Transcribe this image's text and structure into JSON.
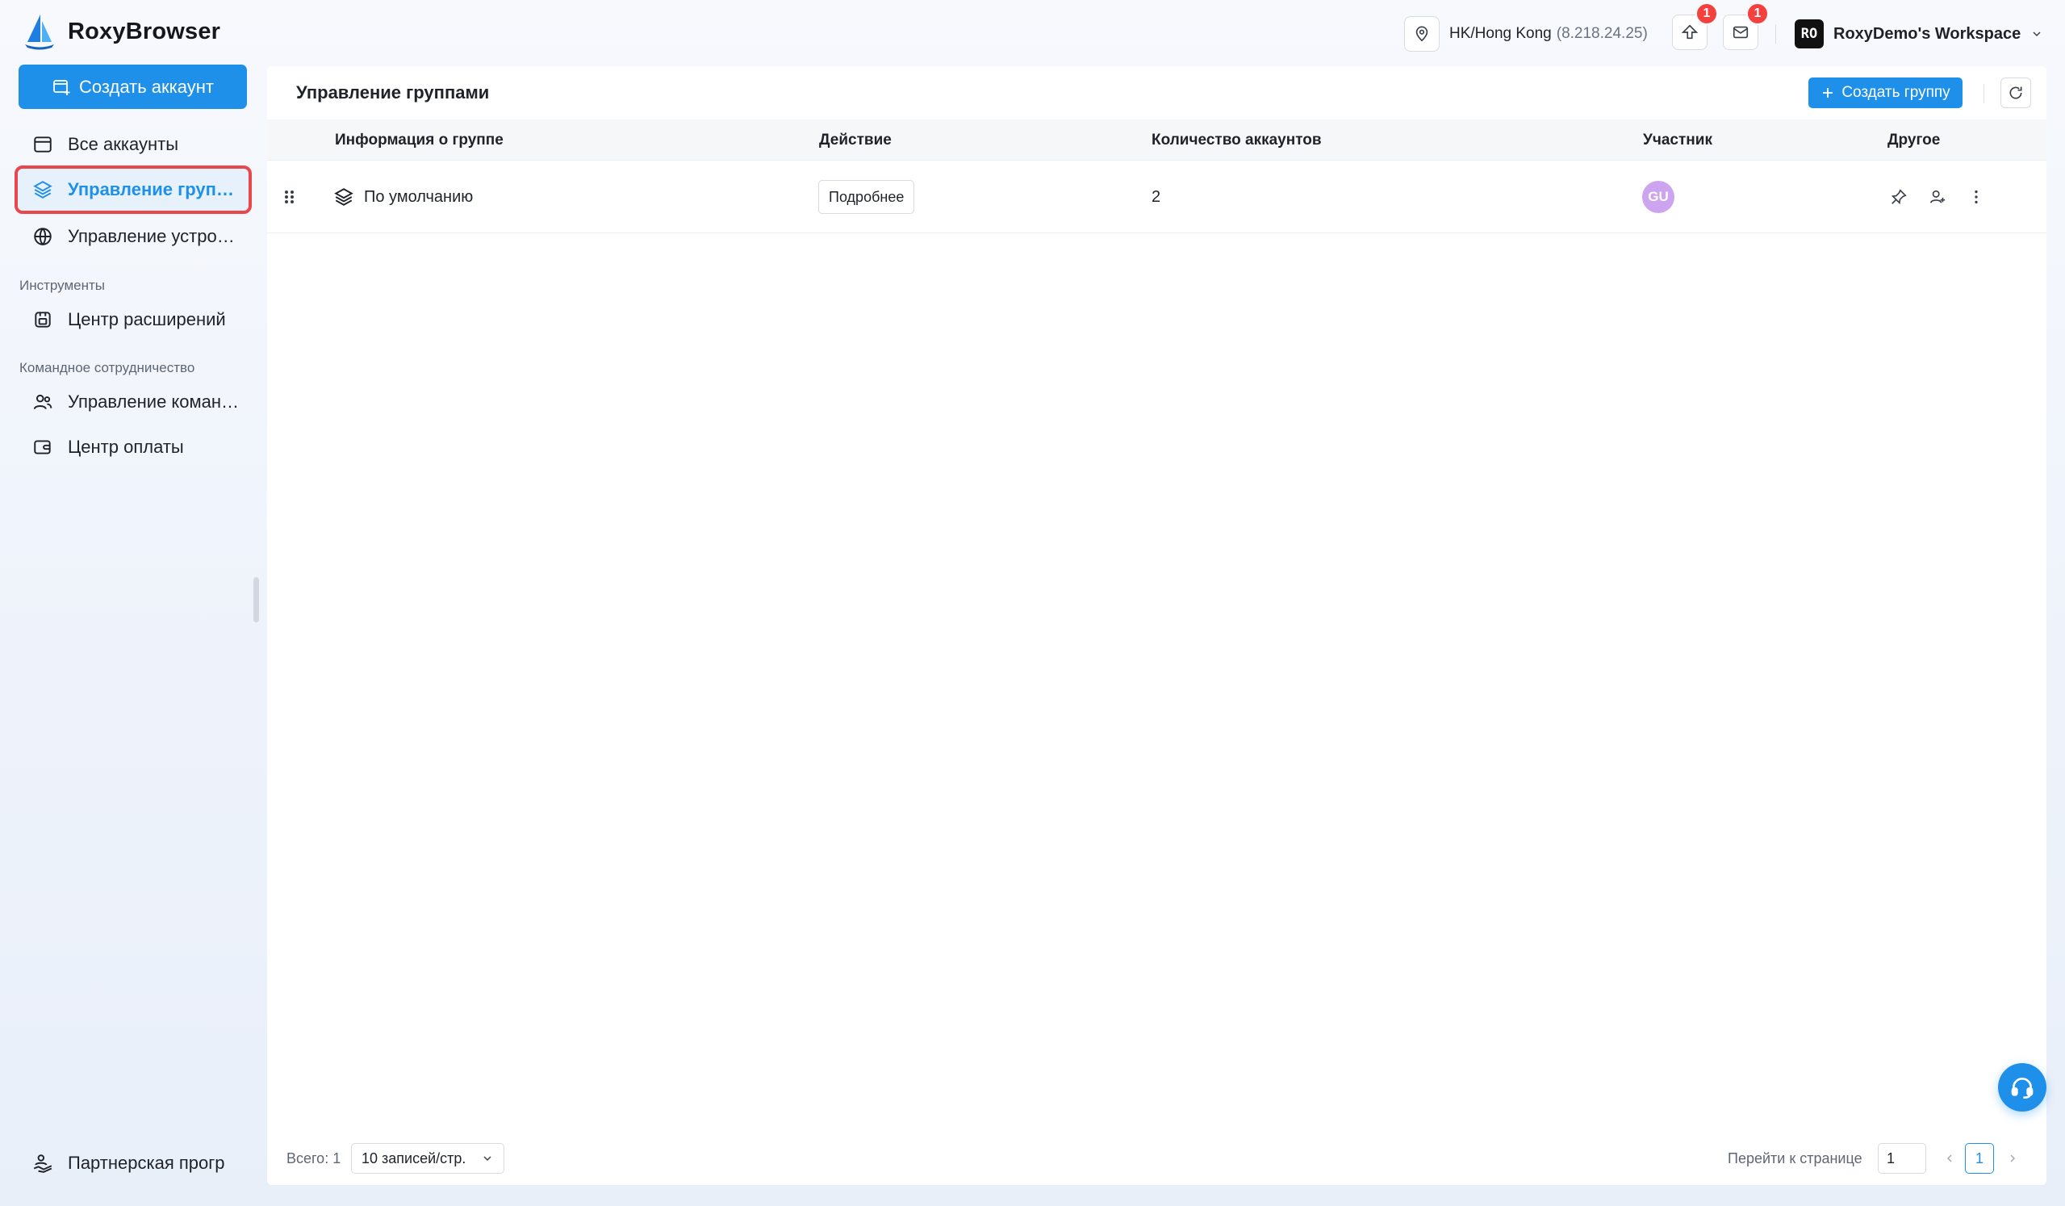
{
  "app": {
    "name": "RoxyBrowser"
  },
  "header": {
    "location": "HK/Hong Kong",
    "ip": "(8.218.24.25)",
    "upgrade_badge": "1",
    "mail_badge": "1",
    "workspace_initials": "RO",
    "workspace_name": "RoxyDemo's Workspace"
  },
  "sidebar": {
    "create_button": "Создать аккаунт",
    "items": [
      {
        "label": "Все аккаунты",
        "icon": "browser-window-icon"
      },
      {
        "label": "Управление группами",
        "icon": "layers-icon",
        "active": true
      },
      {
        "label": "Управление устройствами",
        "icon": "globe-icon"
      }
    ],
    "section_tools": "Инструменты",
    "tools_items": [
      {
        "label": "Центр расширений",
        "icon": "extension-icon"
      }
    ],
    "section_team": "Командное сотрудничество",
    "team_items": [
      {
        "label": "Управление командой",
        "icon": "team-icon"
      },
      {
        "label": "Центр оплаты",
        "icon": "wallet-icon"
      }
    ],
    "bottom_item": {
      "label": "Партнерская прогр",
      "icon": "partner-icon"
    }
  },
  "main": {
    "title": "Управление группами",
    "create_group_button": "Создать группу",
    "table": {
      "columns": [
        "Информация о группе",
        "Действие",
        "Количество аккаунтов",
        "Участник",
        "Другое"
      ],
      "rows": [
        {
          "name": "По умолчанию",
          "action": "Подробнее",
          "count": "2",
          "member": "GU"
        }
      ]
    },
    "pagination": {
      "total": "Всего: 1",
      "page_size": "10 записей/стр.",
      "goto_label": "Перейти к странице",
      "goto_value": "1",
      "current_page": "1"
    }
  },
  "colors": {
    "accent": "#1f90ea",
    "badge": "#f5403d",
    "highlight_border": "#e8474c",
    "member_avatar": "#cda4f0"
  }
}
